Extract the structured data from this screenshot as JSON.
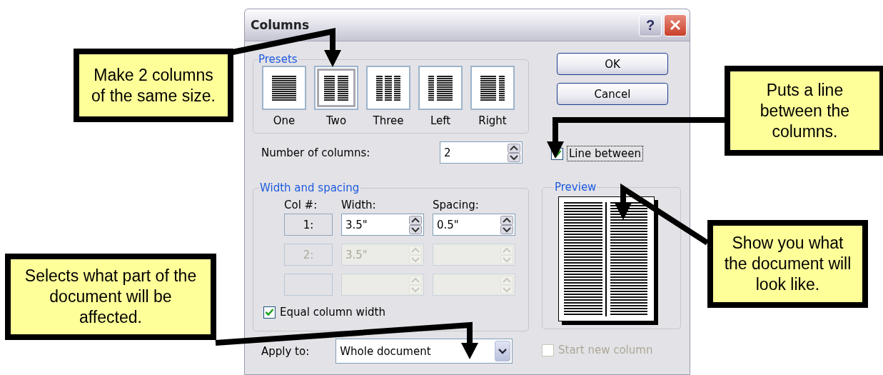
{
  "window": {
    "title": "Columns",
    "help_label": "?"
  },
  "presets": {
    "label": "Presets",
    "items": [
      {
        "label": "One",
        "kind": "one",
        "selected": false
      },
      {
        "label": "Two",
        "kind": "two",
        "selected": true
      },
      {
        "label": "Three",
        "kind": "three",
        "selected": false
      },
      {
        "label": "Left",
        "kind": "left",
        "selected": false
      },
      {
        "label": "Right",
        "kind": "right",
        "selected": false
      }
    ]
  },
  "number_of_columns": {
    "label": "Number of columns:",
    "value": "2"
  },
  "width_and_spacing": {
    "label": "Width and spacing",
    "headers": [
      "Col #:",
      "Width:",
      "Spacing:"
    ],
    "rows": [
      {
        "col": "1:",
        "width": "3.5\"",
        "spacing": "0.5\"",
        "disabled": false
      },
      {
        "col": "2:",
        "width": "3.5\"",
        "disabled": true
      },
      {
        "disabled": true
      }
    ]
  },
  "equal_column_width": {
    "label": "Equal column width",
    "checked": true
  },
  "apply_to": {
    "label": "Apply to:",
    "value": "Whole document"
  },
  "buttons": [
    {
      "label": "OK"
    },
    {
      "label": "Cancel"
    }
  ],
  "line_between": {
    "label": "Line between",
    "checked": true,
    "focused": true
  },
  "preview": {
    "label": "Preview"
  },
  "start_new_column": {
    "label": "Start new column",
    "checked": false,
    "disabled": true
  },
  "callouts": [
    {
      "lines": [
        "Make 2 columns",
        "of the same size."
      ]
    },
    {
      "lines": [
        "Puts a line",
        "between the",
        "columns."
      ]
    },
    {
      "lines": [
        "Show you what",
        "the document will",
        "look like."
      ]
    },
    {
      "lines": [
        "Selects what part of the",
        "document will be",
        "affected."
      ]
    }
  ]
}
